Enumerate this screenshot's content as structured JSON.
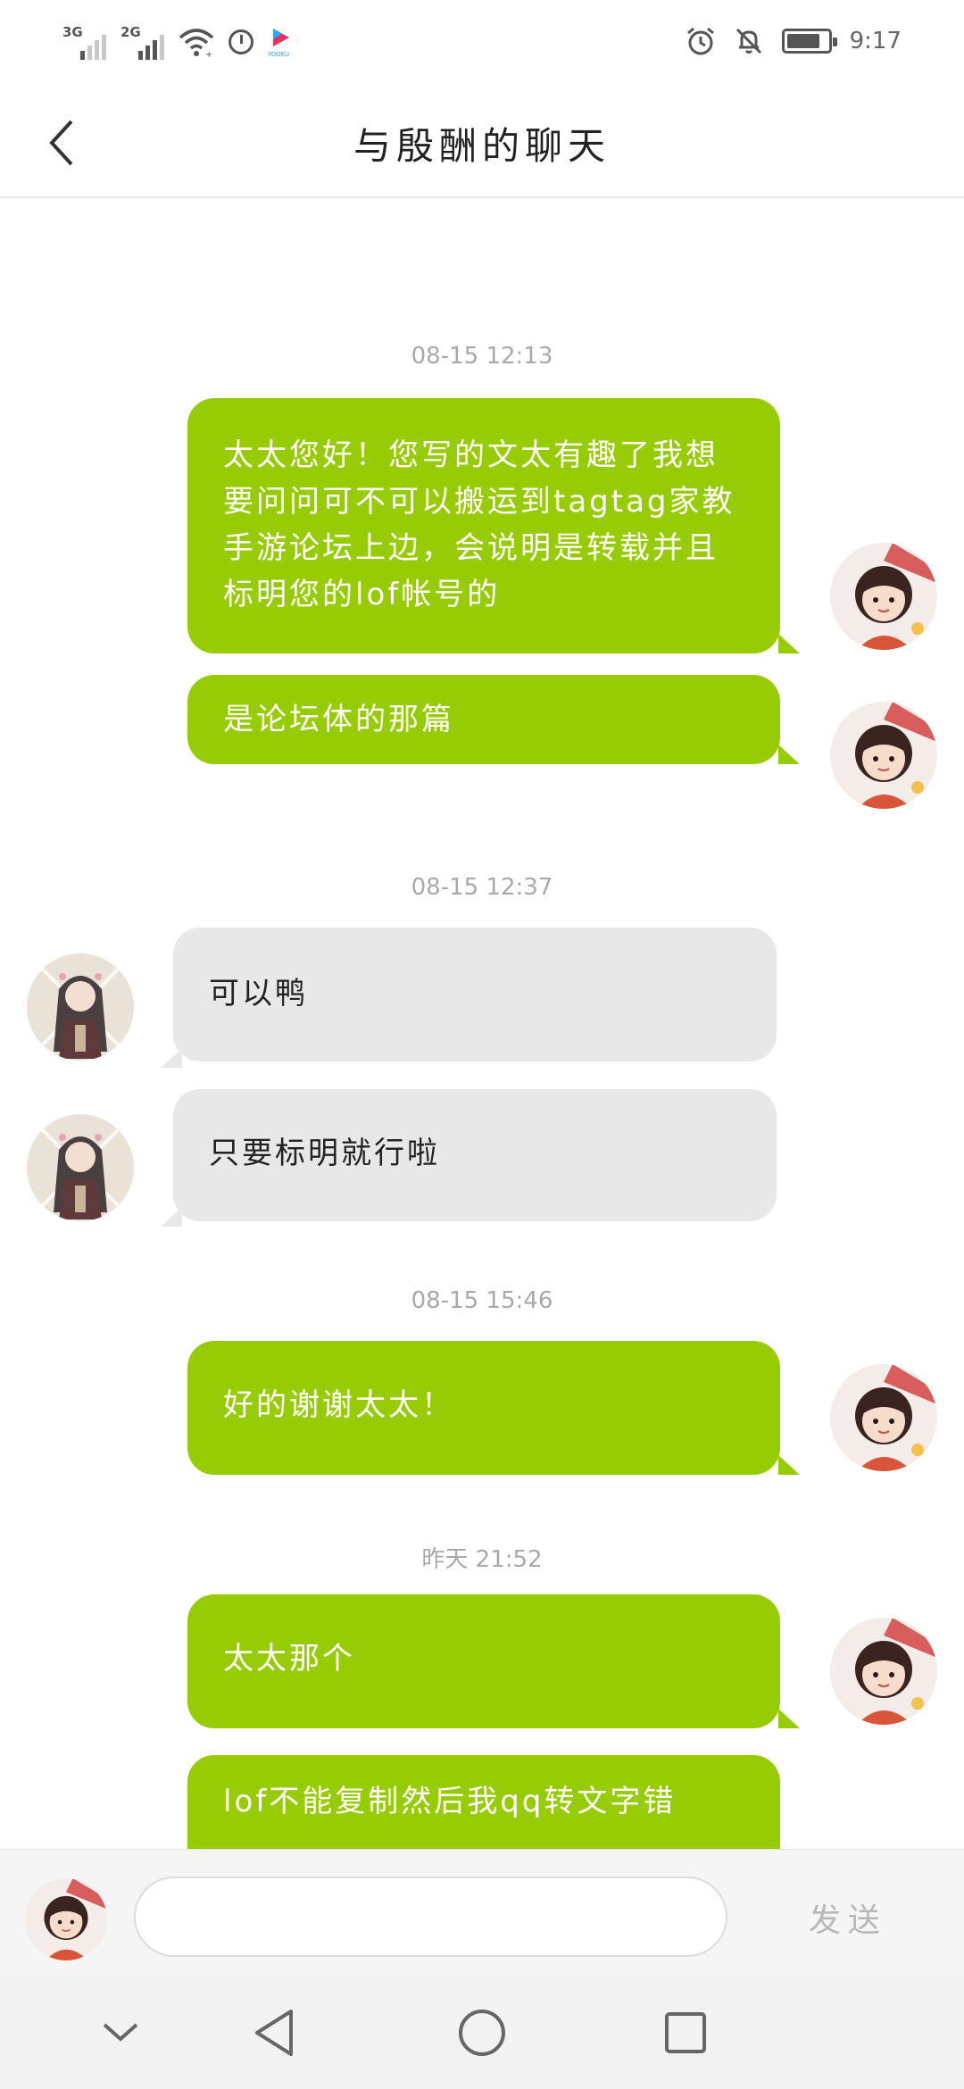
{
  "status_bar": {
    "sim1": "3G",
    "sim2": "2G",
    "time": "9:17",
    "battery_level": 0.75,
    "icons": [
      "signal-icon",
      "signal-icon",
      "wifi-icon",
      "timer-icon",
      "youku-icon",
      "alarm-icon",
      "mute-bell-icon",
      "battery-icon"
    ]
  },
  "header": {
    "title": "与殷酬的聊天",
    "back_icon": "chevron-left-icon"
  },
  "messages": [
    {
      "type": "timestamp",
      "text": "08-15 12:13"
    },
    {
      "type": "message",
      "sender": "me",
      "text": "太太您好！您写的文太有趣了我想要问问可不可以搬运到tagtag家教手游论坛上边，会说明是转载并且标明您的lof帐号的"
    },
    {
      "type": "message",
      "sender": "me",
      "text": "是论坛体的那篇"
    },
    {
      "type": "timestamp",
      "text": "08-15 12:37"
    },
    {
      "type": "message",
      "sender": "them",
      "text": "可以鸭"
    },
    {
      "type": "message",
      "sender": "them",
      "text": "只要标明就行啦"
    },
    {
      "type": "timestamp",
      "text": "08-15 15:46"
    },
    {
      "type": "message",
      "sender": "me",
      "text": "好的谢谢太太！"
    },
    {
      "type": "timestamp",
      "text": "昨天 21:52"
    },
    {
      "type": "message",
      "sender": "me",
      "text": "太太那个"
    },
    {
      "type": "message",
      "sender": "me",
      "text": "lof不能复制然后我qq转文字错"
    }
  ],
  "input": {
    "placeholder": "",
    "value": "",
    "send_label": "发送"
  },
  "nav_bar": {
    "icons": [
      "collapse-icon",
      "back-triangle-icon",
      "home-circle-icon",
      "recents-square-icon"
    ]
  },
  "colors": {
    "my_bubble": "#97cc05",
    "their_bubble": "#e8e8e8",
    "timestamp": "#a9a9a9"
  }
}
